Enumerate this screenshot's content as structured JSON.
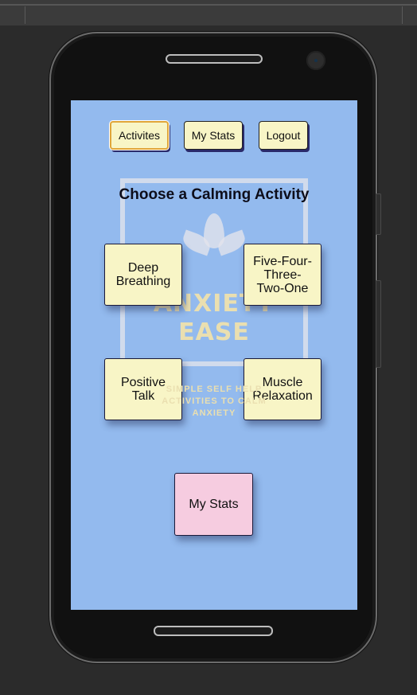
{
  "nav": {
    "activities_label": "Activites",
    "stats_label": "My Stats",
    "logout_label": "Logout"
  },
  "logo": {
    "name": "ANXIETY\nEASE",
    "tagline": "SIMPLE SELF HELP\nACTIVITIES TO CALM\nANXIETY"
  },
  "main": {
    "title": "Choose a Calming Activity",
    "activities": [
      {
        "label": "Deep Breathing"
      },
      {
        "label": "Five-Four-\nThree-\nTwo-One"
      },
      {
        "label": "Positive Talk"
      },
      {
        "label": "Muscle Relaxation"
      }
    ],
    "stats_button": "My Stats"
  },
  "colors": {
    "screen_background": "#93baee",
    "card_background": "#f8f5c6",
    "stats_card_background": "#f6cce0",
    "active_border": "#e0a63a"
  }
}
